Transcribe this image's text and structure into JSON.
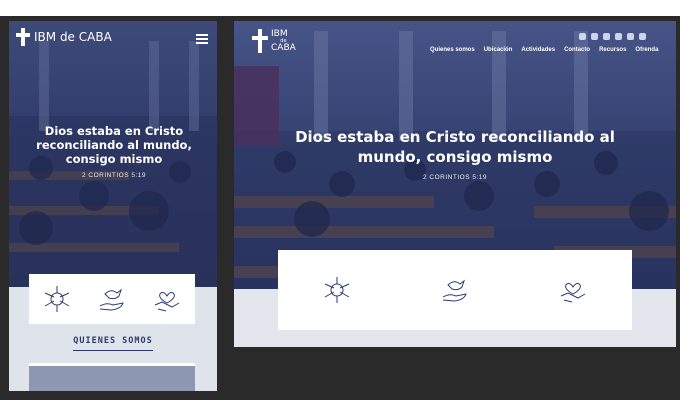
{
  "mobile": {
    "logo_text": "IBM de CABA",
    "hero_title": "Dios estaba en Cristo reconciliando al mundo, consigo mismo",
    "hero_reference": "2 CORINTIOS 5:19",
    "section_title": "QUIENES SOMOS",
    "feature_icons": [
      "hands-together-icon",
      "dove-hand-icon",
      "heart-handshake-icon"
    ]
  },
  "desktop": {
    "logo_line1": "IBM",
    "logo_line2": "de",
    "logo_line3": "CABA",
    "nav": [
      {
        "label": "Quienes somos"
      },
      {
        "label": "Ubicación"
      },
      {
        "label": "Actividades"
      },
      {
        "label": "Contacto"
      },
      {
        "label": "Recursos"
      },
      {
        "label": "Ofrenda"
      }
    ],
    "social_icons": [
      "instagram-icon",
      "facebook-icon",
      "spotify-icon",
      "youtube-icon",
      "whatsapp-icon",
      "email-icon"
    ],
    "hero_title": "Dios estaba en Cristo reconciliando al mundo, consigo mismo",
    "hero_reference": "2 CORINTIOS 5:19",
    "feature_icons": [
      "hands-together-icon",
      "dove-hand-icon",
      "heart-handshake-icon"
    ]
  },
  "colors": {
    "accent": "#2b3a6e",
    "hero_overlay": "#34406c",
    "line_icon": "#2b3a6e"
  }
}
